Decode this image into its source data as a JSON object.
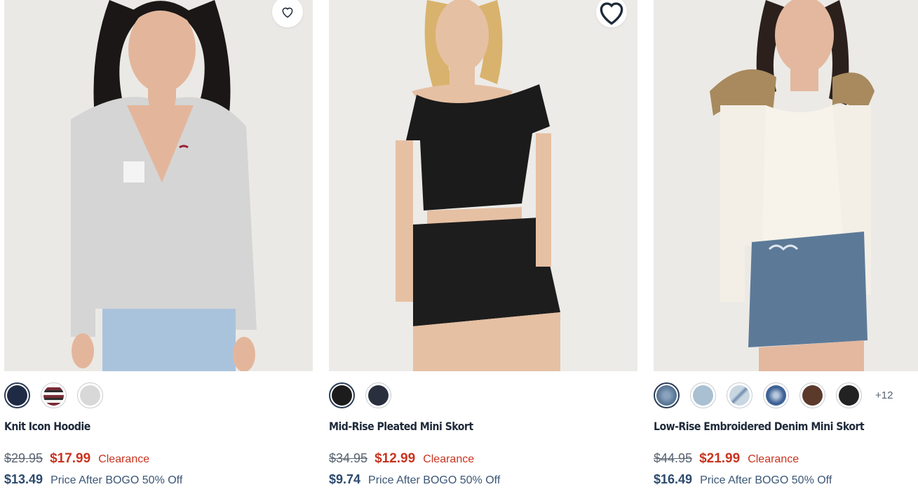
{
  "products": [
    {
      "name": "Knit Icon Hoodie",
      "original_price": "$29.95",
      "sale_price": "$17.99",
      "badge": "Clearance",
      "bogo_price": "$13.49",
      "bogo_label": "Price After BOGO 50% Off",
      "swatches": [
        "#1f2a44",
        "#7a2b36",
        "#d8d8d8"
      ],
      "more_colors": ""
    },
    {
      "name": "Mid-Rise Pleated Mini Skort",
      "original_price": "$34.95",
      "sale_price": "$12.99",
      "badge": "Clearance",
      "bogo_price": "$9.74",
      "bogo_label": "Price After BOGO 50% Off",
      "swatches": [
        "#1c1c1c",
        "#2a2f3e"
      ],
      "more_colors": ""
    },
    {
      "name": "Low-Rise Embroidered Denim Mini Skort",
      "original_price": "$44.95",
      "sale_price": "$21.99",
      "badge": "Clearance",
      "bogo_price": "$16.49",
      "bogo_label": "Price After BOGO 50% Off",
      "swatches": [
        "#5a7898",
        "#a9bfd2",
        "#c9d7e3",
        "#3f6396",
        "#5b3a2c",
        "#222222"
      ],
      "more_colors": "+12"
    }
  ],
  "icons": {
    "wishlist": "heart-outline-icon"
  }
}
